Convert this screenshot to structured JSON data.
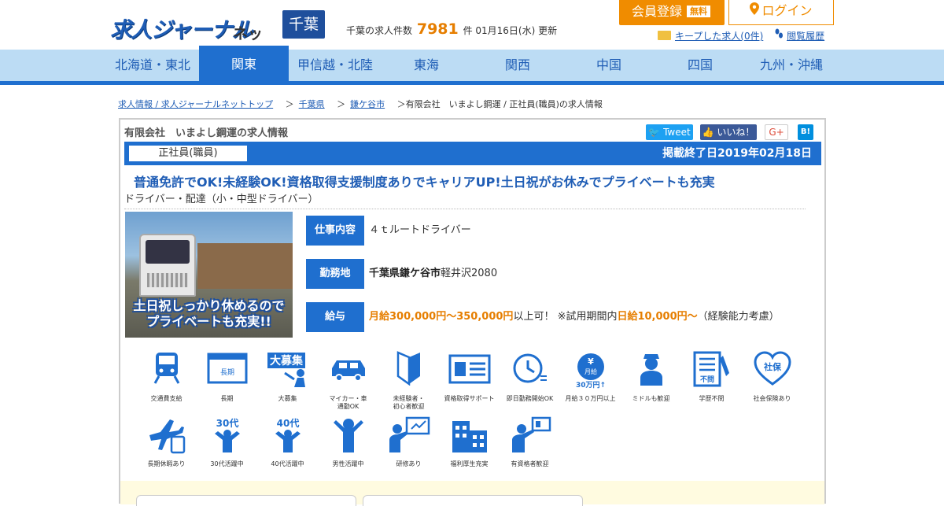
{
  "header": {
    "logo_main": "求人ジャーナル",
    "logo_net": "ネット",
    "prefecture": "千葉",
    "job_count_prefix": "千葉の求人件数",
    "job_count": "7981",
    "job_count_suffix": "件 01月16日(水) 更新",
    "register_label": "会員登録",
    "register_free": "無料",
    "login_label": "ログイン",
    "kept_jobs": "キープした求人(0件)",
    "history": "閲覧履歴"
  },
  "nav": {
    "items": [
      "北海道・東北",
      "関東",
      "甲信越・北陸",
      "東海",
      "関西",
      "中国",
      "四国",
      "九州・沖縄"
    ],
    "active_index": 1
  },
  "breadcrumb": {
    "items": [
      "求人情報 / 求人ジャーナルネットトップ",
      "千葉県",
      "鎌ケ谷市"
    ],
    "current": "有限会社　いまよし鋼運 / 正社員(職員)の求人情報",
    "separator": "＞"
  },
  "job": {
    "company": "有限会社　いまよし鋼運の求人情報",
    "employment_type": "正社員(職員)",
    "end_date": "掲載終了日2019年02月18日",
    "headline": "普通免許でOK!未経験OK!資格取得支援制度ありでキャリアUP!土日祝がお休みでプライベートも充実",
    "category": "ドライバー・配達（小・中型ドライバー）",
    "photo_caption_1": "土日祝しっかり休めるので",
    "photo_caption_2": "プライベートも充実!!",
    "work_label": "仕事内容",
    "work_value": "４ｔルートドライバー",
    "location_label": "勤務地",
    "location_bold": "千葉県鎌ケ谷市",
    "location_rest": "軽井沢2080",
    "salary_label": "給与",
    "salary_main": "月給300,000円～350,000円",
    "salary_mid": "以上可！ ※試用期間内",
    "salary_trial": "日給10,000円～",
    "salary_note": "（経験能力考慮）"
  },
  "social": {
    "tweet": "Tweet",
    "like": "いいね！",
    "gplus": "G+",
    "hatena": "B!"
  },
  "features": [
    {
      "icon": "train-icon",
      "label": "交通費支給"
    },
    {
      "icon": "long-term-icon",
      "label": "長期",
      "text": "長期"
    },
    {
      "icon": "mass-hiring-icon",
      "label": "大募集",
      "text": "大募集"
    },
    {
      "icon": "car-icon",
      "label": "マイカー・車\n通勤OK"
    },
    {
      "icon": "beginner-mark-icon",
      "label": "未経験者・\n初心者歓迎"
    },
    {
      "icon": "license-card-icon",
      "label": "資格取得サポート"
    },
    {
      "icon": "clock-icon",
      "label": "即日勤務開始OK"
    },
    {
      "icon": "yen-icon",
      "label": "月給３０万円以上",
      "text": "月給",
      "text2": "30万円↑"
    },
    {
      "icon": "middle-age-icon",
      "label": "ミドルも歓迎"
    },
    {
      "icon": "no-education-icon",
      "label": "学歴不問",
      "text": "不問"
    },
    {
      "icon": "insurance-heart-icon",
      "label": "社会保険あり",
      "text": "社保"
    },
    {
      "icon": "airplane-icon",
      "label": "長期休暇あり"
    },
    {
      "icon": "thirties-icon",
      "label": "30代活躍中",
      "text": "30代"
    },
    {
      "icon": "forties-icon",
      "label": "40代活躍中",
      "text": "40代"
    },
    {
      "icon": "male-active-icon",
      "label": "男性活躍中"
    },
    {
      "icon": "training-icon",
      "label": "研修あり"
    },
    {
      "icon": "welfare-building-icon",
      "label": "福利厚生充実"
    },
    {
      "icon": "qualified-icon",
      "label": "有資格者歓迎"
    }
  ],
  "colors": {
    "primary": "#1f6fcf",
    "accent": "#f08c00",
    "nav_bg": "#bcdcf4"
  }
}
